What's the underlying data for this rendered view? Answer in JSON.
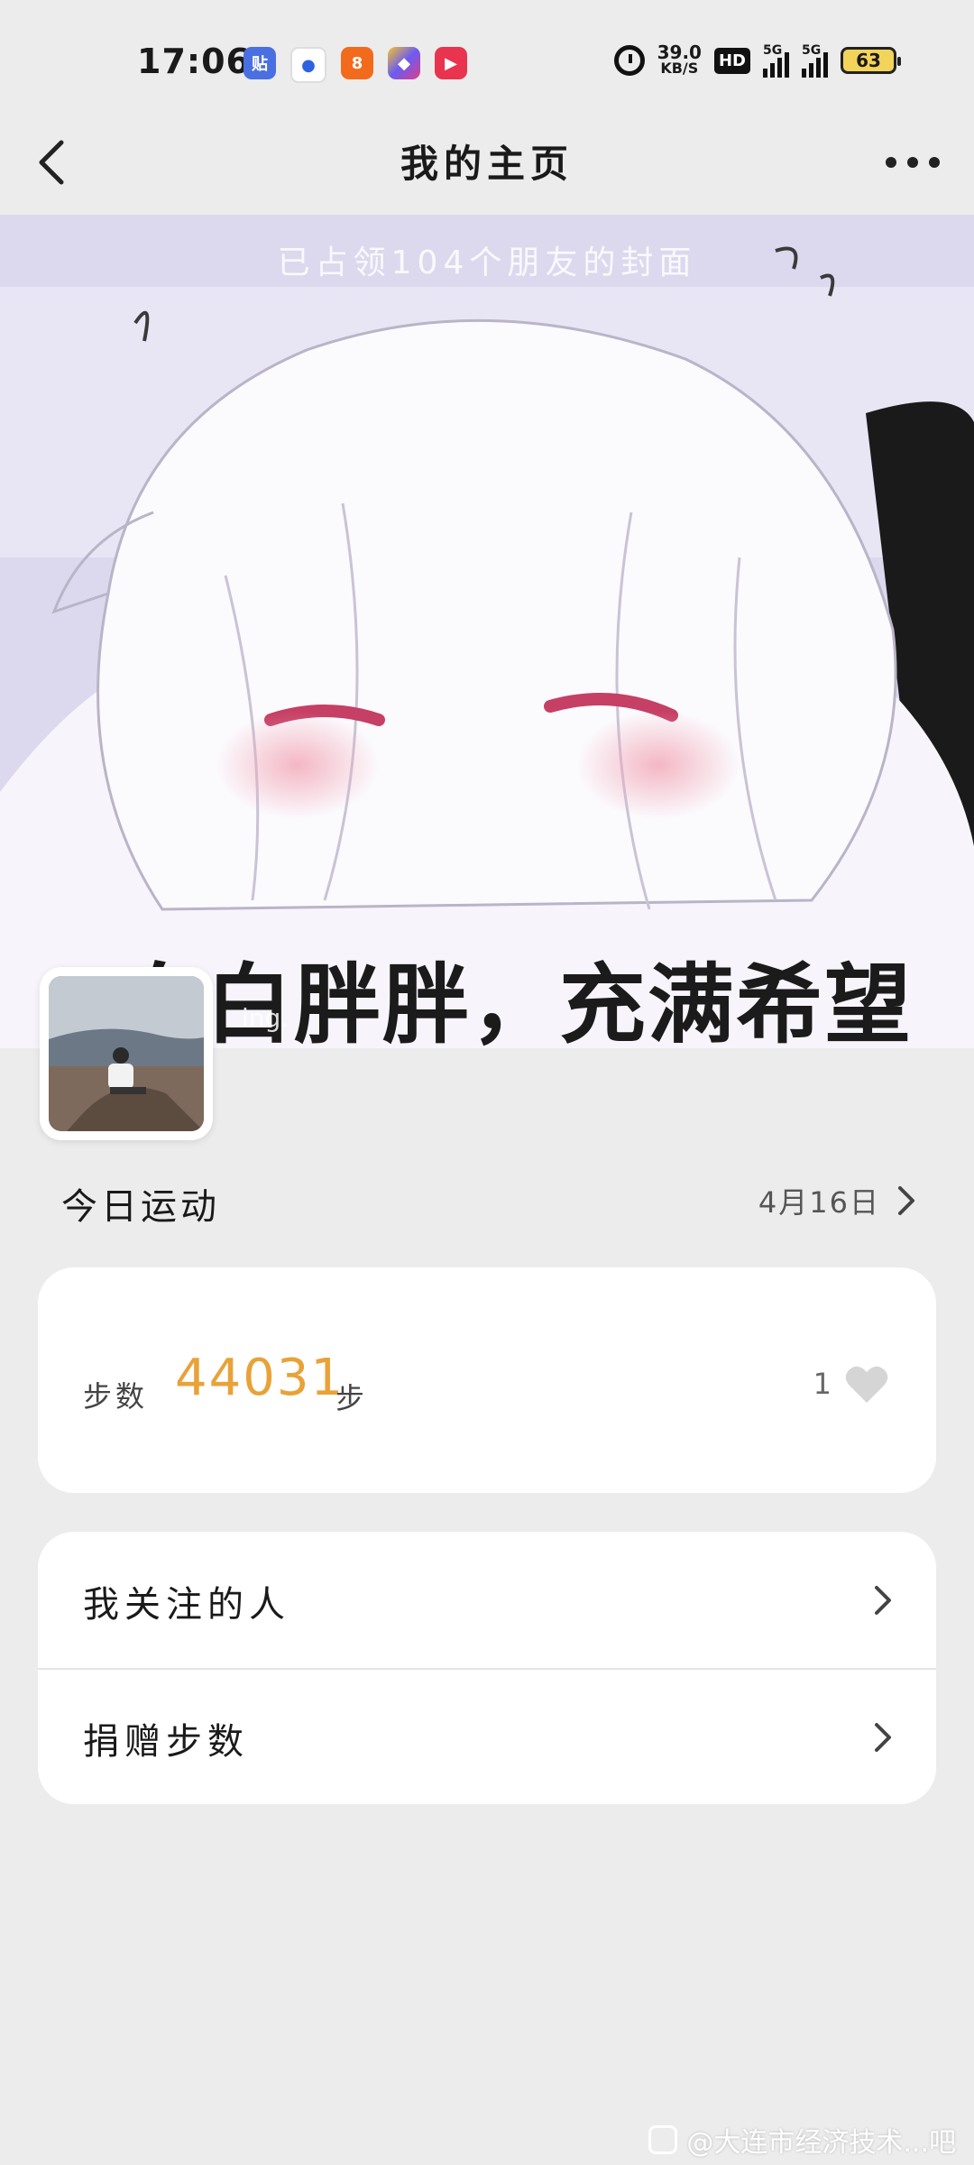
{
  "status_bar": {
    "time": "17:06",
    "network_speed": "39.0",
    "network_speed_unit": "KB/S",
    "hd_badge": "HD",
    "signal1": "5G",
    "signal2": "5G",
    "battery": "63",
    "app_icons": [
      "tieba-icon",
      "baidu-icon",
      "app-orange-icon",
      "app-colorful-icon",
      "video-play-icon"
    ]
  },
  "header": {
    "title": "我的主页"
  },
  "cover": {
    "caption": "已占领104个朋友的封面",
    "image_text": "白白胖胖，充满希望",
    "avatar_tag": "ing."
  },
  "today": {
    "section_title": "今日运动",
    "date": "4月16日",
    "steps_label": "步数",
    "steps_value": "44031",
    "steps_unit": "步",
    "like_count": "1"
  },
  "menu": {
    "items": [
      {
        "label": "我关注的人"
      },
      {
        "label": "捐赠步数"
      }
    ]
  },
  "watermark": "@大连市经济技术...吧",
  "colors": {
    "accent_orange": "#e8a238",
    "background": "#ececec",
    "card": "#ffffff"
  }
}
